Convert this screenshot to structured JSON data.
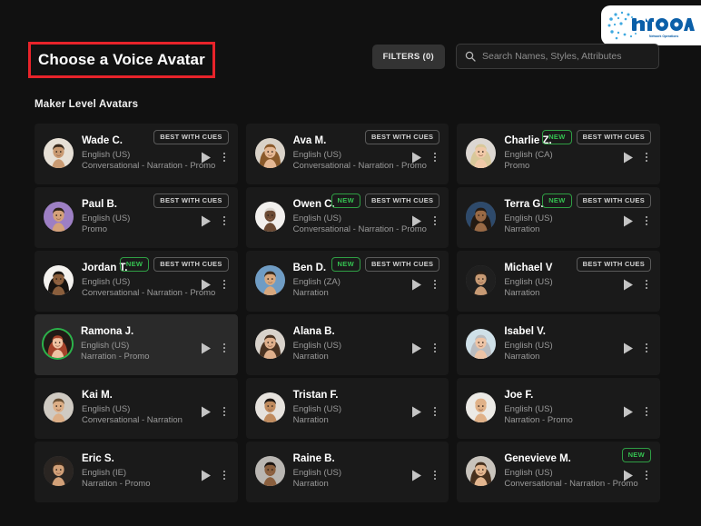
{
  "brand": {
    "logo_text": "nFOA",
    "logo_tagline": "Network Operations",
    "logo_color": "#1a7fd4"
  },
  "header": {
    "page_title": "Choose a Voice Avatar",
    "title_highlight_color": "#e8232a",
    "filters_label": "FILTERS (0)",
    "search_placeholder": "Search Names, Styles, Attributes",
    "search_value": "",
    "search_icon": "search-icon"
  },
  "section": {
    "title": "Maker Level Avatars"
  },
  "badges": {
    "cues": "BEST WITH CUES",
    "new": "NEW",
    "new_color": "#35c251"
  },
  "icons": {
    "play": "play-icon",
    "menu": "kebab-menu-icon"
  },
  "avatars": [
    {
      "name": "Wade C.",
      "language": "English (US)",
      "styles": "Conversational - Narration - Promo",
      "best_with_cues": true,
      "is_new": false,
      "selected": false,
      "skin": "#c99a72",
      "hair": "#3a2a1c",
      "bg": "#e7e0d6",
      "gender": "m"
    },
    {
      "name": "Ava M.",
      "language": "English (US)",
      "styles": "Conversational - Narration - Promo",
      "best_with_cues": true,
      "is_new": false,
      "selected": false,
      "skin": "#e5b894",
      "hair": "#8a5a2b",
      "bg": "#d9d2c8",
      "gender": "f"
    },
    {
      "name": "Charlie Z.",
      "language": "English (CA)",
      "styles": "Promo",
      "best_with_cues": true,
      "is_new": true,
      "selected": false,
      "skin": "#f0c9a8",
      "hair": "#d8c89a",
      "bg": "#dcd7d2",
      "gender": "f"
    },
    {
      "name": "Paul B.",
      "language": "English (US)",
      "styles": "Promo",
      "best_with_cues": true,
      "is_new": false,
      "selected": false,
      "skin": "#d4a179",
      "hair": "#2c2118",
      "bg": "#9d7fc4",
      "gender": "m"
    },
    {
      "name": "Owen C.",
      "language": "English (US)",
      "styles": "Conversational - Narration - Promo",
      "best_with_cues": true,
      "is_new": true,
      "selected": false,
      "skin": "#6b4a34",
      "hair": "#ddd8d2",
      "bg": "#f2f0ee",
      "gender": "m"
    },
    {
      "name": "Terra G.",
      "language": "English (US)",
      "styles": "Narration",
      "best_with_cues": true,
      "is_new": true,
      "selected": false,
      "skin": "#9a6a45",
      "hair": "#241a12",
      "bg": "#2e4a6b",
      "gender": "f"
    },
    {
      "name": "Jordan T.",
      "language": "English (US)",
      "styles": "Conversational - Narration - Promo",
      "best_with_cues": true,
      "is_new": true,
      "selected": false,
      "skin": "#8a5e3c",
      "hair": "#171310",
      "bg": "#f4f2ef",
      "gender": "f"
    },
    {
      "name": "Ben D.",
      "language": "English (ZA)",
      "styles": "Narration",
      "best_with_cues": true,
      "is_new": true,
      "selected": false,
      "skin": "#d8a87e",
      "hair": "#3a2b1d",
      "bg": "#6f9cc4",
      "gender": "m"
    },
    {
      "name": "Michael V",
      "language": "English (US)",
      "styles": "Narration",
      "best_with_cues": true,
      "is_new": false,
      "selected": false,
      "skin": "#c79a74",
      "hair": "#2a2018",
      "bg": "#1f1f1f",
      "gender": "m"
    },
    {
      "name": "Ramona J.",
      "language": "English (US)",
      "styles": "Narration - Promo",
      "best_with_cues": false,
      "is_new": false,
      "selected": true,
      "skin": "#f0c3a2",
      "hair": "#a5432a",
      "bg": "#201a16",
      "gender": "f"
    },
    {
      "name": "Alana B.",
      "language": "English (US)",
      "styles": "Narration",
      "best_with_cues": false,
      "is_new": false,
      "selected": false,
      "skin": "#e0b08c",
      "hair": "#4a3322",
      "bg": "#d8d2cb",
      "gender": "f"
    },
    {
      "name": "Isabel V.",
      "language": "English (US)",
      "styles": "Narration",
      "best_with_cues": false,
      "is_new": false,
      "selected": false,
      "skin": "#edc4a6",
      "hair": "#b9bcc0",
      "bg": "#cfe0e8",
      "gender": "f"
    },
    {
      "name": "Kai M.",
      "language": "English (US)",
      "styles": "Conversational - Narration",
      "best_with_cues": false,
      "is_new": false,
      "selected": false,
      "skin": "#dcae86",
      "hair": "#6b5135",
      "bg": "#cfcac2",
      "gender": "m"
    },
    {
      "name": "Tristan F.",
      "language": "English (US)",
      "styles": "Narration",
      "best_with_cues": false,
      "is_new": false,
      "selected": false,
      "skin": "#c08b5e",
      "hair": "#1e1712",
      "bg": "#e6e2dd",
      "gender": "m"
    },
    {
      "name": "Joe F.",
      "language": "English (US)",
      "styles": "Narration - Promo",
      "best_with_cues": false,
      "is_new": false,
      "selected": false,
      "skin": "#e0b188",
      "hair": "#e0b188",
      "bg": "#eceae6",
      "gender": "m"
    },
    {
      "name": "Eric S.",
      "language": "English (IE)",
      "styles": "Narration - Promo",
      "best_with_cues": false,
      "is_new": false,
      "selected": false,
      "skin": "#d2a078",
      "hair": "#3c2a1c",
      "bg": "#2a2522",
      "gender": "m"
    },
    {
      "name": "Raine B.",
      "language": "English (US)",
      "styles": "Narration",
      "best_with_cues": false,
      "is_new": false,
      "selected": false,
      "skin": "#8a5f3e",
      "hair": "#191310",
      "bg": "#b9b6b2",
      "gender": "m"
    },
    {
      "name": "Genevieve M.",
      "language": "English (US)",
      "styles": "Conversational - Narration - Promo",
      "best_with_cues": false,
      "is_new": true,
      "selected": false,
      "skin": "#e3b68f",
      "hair": "#46301e",
      "bg": "#c8c3bc",
      "gender": "f"
    }
  ]
}
